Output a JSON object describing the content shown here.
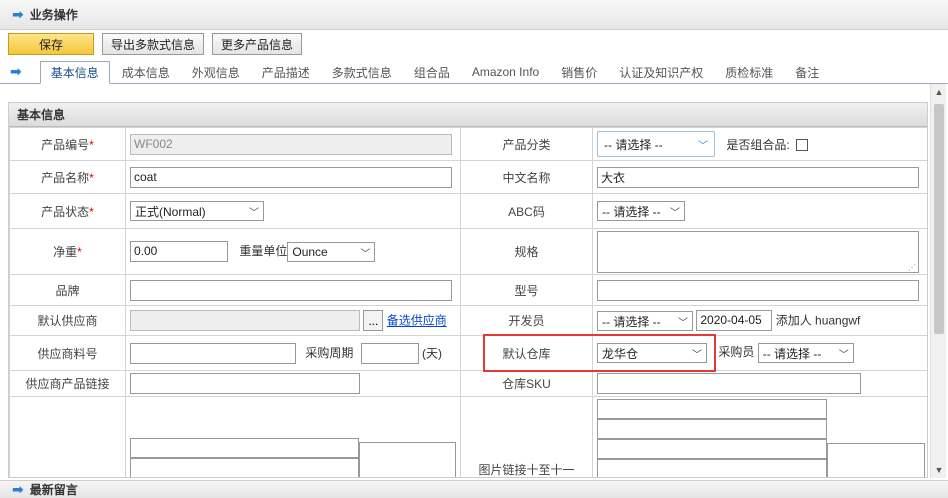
{
  "title": "业务操作",
  "toolbar": {
    "save": "保存",
    "export_variants": "导出多款式信息",
    "more_product_info": "更多产品信息"
  },
  "tabs": [
    {
      "label": "基本信息",
      "active": true
    },
    {
      "label": "成本信息"
    },
    {
      "label": "外观信息"
    },
    {
      "label": "产品描述"
    },
    {
      "label": "多款式信息"
    },
    {
      "label": "组合品"
    },
    {
      "label": "Amazon Info"
    },
    {
      "label": "销售价"
    },
    {
      "label": "认证及知识产权"
    },
    {
      "label": "质检标准"
    },
    {
      "label": "备注"
    }
  ],
  "section_title": "基本信息",
  "form": {
    "product_code": {
      "label": "产品编号",
      "req": "*",
      "value": "WF002"
    },
    "product_category": {
      "label": "产品分类",
      "value": "-- 请选择 --"
    },
    "is_combo": {
      "label": "是否组合品:"
    },
    "product_name": {
      "label": "产品名称",
      "req": "*",
      "value": "coat"
    },
    "chinese_name": {
      "label": "中文名称",
      "value": "大衣"
    },
    "product_status": {
      "label": "产品状态",
      "req": "*",
      "value": "正式(Normal)"
    },
    "abc_code": {
      "label": "ABC码",
      "value": "-- 请选择 --"
    },
    "net_weight": {
      "label": "净重",
      "req": "*",
      "value": "0.00"
    },
    "weight_unit": {
      "label": "重量单位",
      "value": "Ounce"
    },
    "spec": {
      "label": "规格"
    },
    "brand": {
      "label": "品牌"
    },
    "model": {
      "label": "型号"
    },
    "default_supplier": {
      "label": "默认供应商",
      "dots": "...",
      "link": "备选供应商"
    },
    "developer": {
      "label": "开发员",
      "value": "-- 请选择 --",
      "date": "2020-04-05",
      "added_by": "添加人 huangwf"
    },
    "supplier_item_no": {
      "label": "供应商料号"
    },
    "purchase_cycle": {
      "label": "采购周期",
      "unit": "(天)"
    },
    "default_warehouse": {
      "label": "默认仓库",
      "value": "龙华仓"
    },
    "buyer": {
      "label": "采购员",
      "value": "-- 请选择 --"
    },
    "supplier_product_link": {
      "label": "供应商产品链接"
    },
    "warehouse_sku": {
      "label": "仓库SKU"
    },
    "image_links": {
      "label": "图片链接十至十一"
    }
  },
  "footer": "最新留言",
  "colors": {
    "accent": "#2a7fd4",
    "save": "#f4c63a",
    "highlight": "#e53935"
  }
}
